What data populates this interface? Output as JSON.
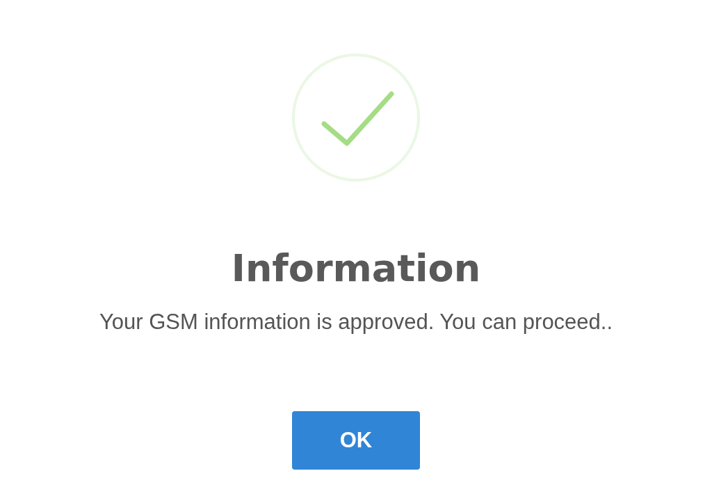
{
  "dialog": {
    "icon": {
      "kind": "success"
    },
    "title": "Information",
    "message": "Your GSM information is approved. You can proceed..",
    "buttons": [
      {
        "label": "OK"
      }
    ]
  }
}
